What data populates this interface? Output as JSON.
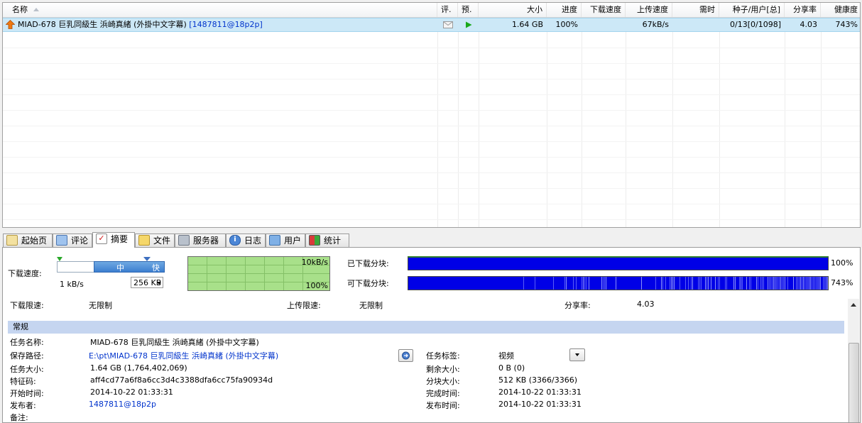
{
  "columns": {
    "name": "名称",
    "comment": "评.",
    "preview": "预.",
    "size": "大小",
    "progress": "进度",
    "download_speed": "下载速度",
    "upload_speed": "上传速度",
    "eta": "需时",
    "seeds_peers": "种子/用户[总]",
    "ratio": "分享率",
    "health": "健康度"
  },
  "torrent": {
    "name": "MIAD-678 巨乳同級生 浜崎真緒 (外掛中文字幕)",
    "tag": "[1487811@18p2p]",
    "size": "1.64 GB",
    "progress": "100%",
    "download_speed": "",
    "upload_speed": "67kB/s",
    "eta": "",
    "seeds_peers": "0/13[0/1098]",
    "ratio": "4.03",
    "health": "743%"
  },
  "tabs": [
    {
      "label": "起始页",
      "icon": "home-page-icon"
    },
    {
      "label": "评论",
      "icon": "comment-icon"
    },
    {
      "label": "摘要",
      "icon": "summary-check-icon"
    },
    {
      "label": "文件",
      "icon": "file-icon"
    },
    {
      "label": "服务器",
      "icon": "server-icon"
    },
    {
      "label": "日志",
      "icon": "log-info-icon"
    },
    {
      "label": "用户",
      "icon": "user-icon"
    },
    {
      "label": "统计",
      "icon": "stats-icon"
    }
  ],
  "active_tab": "摘要",
  "speed": {
    "label": "下载速度:",
    "mid_label": "中",
    "fast_label": "快",
    "min_value": "1 kB/s",
    "dropdown_value": "256 KB"
  },
  "graph": {
    "top_label": "10kB/s",
    "bottom_label": "100%"
  },
  "pieces": {
    "downloaded_label": "已下载分块:",
    "downloaded_pct": "100%",
    "available_label": "可下载分块:",
    "available_pct": "743%"
  },
  "limits": {
    "download_limit_label": "下载限速:",
    "download_limit_value": "无限制",
    "upload_limit_label": "上传限速:",
    "upload_limit_value": "无限制",
    "ratio_label": "分享率:",
    "ratio_value": "4.03"
  },
  "general": {
    "section_title": "常规",
    "task_name_label": "任务名称:",
    "task_name_value": "MIAD-678 巨乳同級生 浜崎真緒 (外掛中文字幕)",
    "save_path_label": "保存路径:",
    "save_path_value": "E:\\pt\\MIAD-678 巨乳同級生 浜崎真緒 (外掛中文字幕)",
    "task_size_label": "任务大小:",
    "task_size_value": "1.64 GB (1,764,402,069)",
    "hash_label": "特征码:",
    "hash_value": "aff4cd77a6f8a6cc3d4c3388dfa6cc75fa90934d",
    "start_time_label": "开始时间:",
    "start_time_value": "2014-10-22 01:33:31",
    "publisher_label": "发布者:",
    "publisher_value": "1487811@18p2p",
    "notes_label": "备注:",
    "task_tag_label": "任务标签:",
    "task_tag_value": "视频",
    "remaining_label": "剩余大小:",
    "remaining_value": "0 B (0)",
    "piece_size_label": "分块大小:",
    "piece_size_value": "512 KB (3366/3366)",
    "complete_time_label": "完成时间:",
    "complete_time_value": "2014-10-22 01:33:31",
    "publish_time_label": "发布时间:",
    "publish_time_value": "2014-10-22 01:33:31"
  },
  "colors": {
    "selected_row": "#cce8f7",
    "piece_bar": "#0000e6",
    "graph_bg": "#a8e08a",
    "section_bg": "#c5d5f0",
    "link": "#0033cc"
  }
}
